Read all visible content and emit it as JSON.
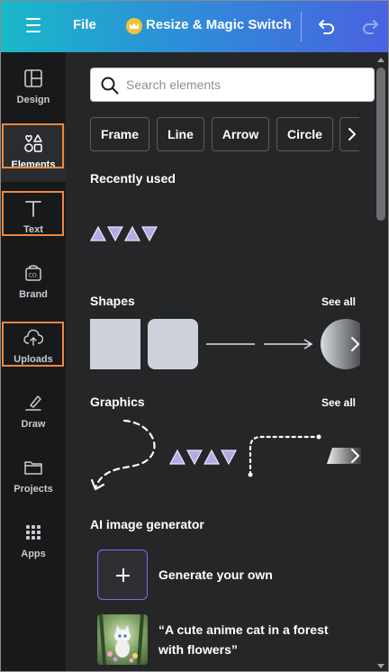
{
  "topbar": {
    "file_label": "File",
    "resize_label": "Resize & Magic Switch"
  },
  "rail": [
    {
      "label": "Design",
      "icon": "layout-icon"
    },
    {
      "label": "Elements",
      "icon": "shapes-icon",
      "active": true
    },
    {
      "label": "Text",
      "icon": "text-icon"
    },
    {
      "label": "Brand",
      "icon": "brand-icon"
    },
    {
      "label": "Uploads",
      "icon": "cloud-upload-icon"
    },
    {
      "label": "Draw",
      "icon": "pen-icon"
    },
    {
      "label": "Projects",
      "icon": "folder-icon"
    },
    {
      "label": "Apps",
      "icon": "grid-icon"
    }
  ],
  "search": {
    "placeholder": "Search elements"
  },
  "chips": [
    "Frame",
    "Line",
    "Arrow",
    "Circle"
  ],
  "sections": {
    "recent": "Recently used",
    "shapes": "Shapes",
    "graphics": "Graphics",
    "ai": "AI image generator",
    "see_all": "See all"
  },
  "ai": {
    "generate": "Generate your own",
    "prompt_line1": "“A cute anime cat in a forest",
    "prompt_line2": "with flowers”"
  },
  "colors": {
    "accent_highlight": "#f0883a",
    "ai_border": "#7d6cf5",
    "triangle": "#b9a7e6"
  }
}
